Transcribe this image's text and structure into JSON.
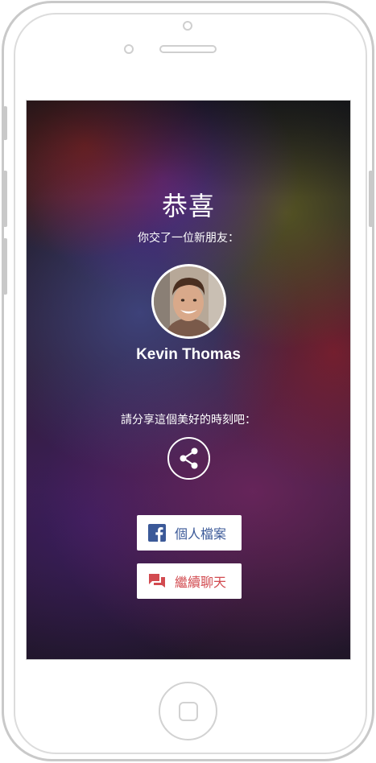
{
  "screen": {
    "title": "恭喜",
    "subtitle": "你交了一位新朋友：",
    "friend_name": "Kevin Thomas",
    "share_prompt": "請分享這個美好的時刻吧：",
    "profile_button_label": "個人檔案",
    "chat_button_label": "繼續聊天"
  },
  "icons": {
    "share": "share-icon",
    "facebook": "facebook-icon",
    "chat": "chat-bubbles-icon",
    "avatar": "user-avatar-photo"
  },
  "colors": {
    "facebook_blue": "#3b5998",
    "chat_red": "#d24b50",
    "text_white": "#ffffff"
  }
}
